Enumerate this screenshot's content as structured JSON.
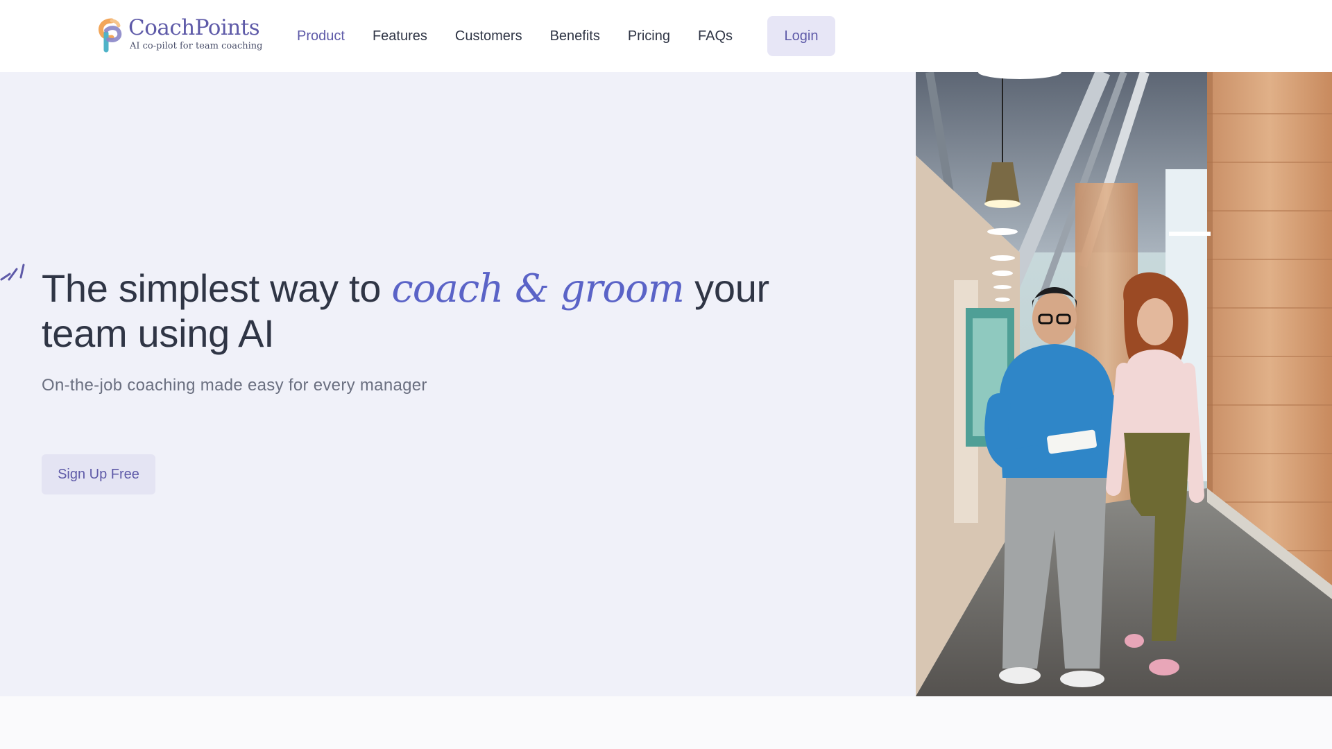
{
  "brand": {
    "name": "CoachPoints",
    "tagline": "AI co-pilot for team coaching",
    "logo_icon": "cp-logo-icon",
    "colors": {
      "primary": "#5e5aa8",
      "accent": "#5a63c7",
      "orange": "#f2a65a",
      "teal": "#4fb3c8"
    }
  },
  "nav": {
    "items": [
      {
        "label": "Product",
        "active": true
      },
      {
        "label": "Features"
      },
      {
        "label": "Customers"
      },
      {
        "label": "Benefits"
      },
      {
        "label": "Pricing"
      },
      {
        "label": "FAQs"
      }
    ],
    "login_label": "Login"
  },
  "hero": {
    "title_before": "The simplest way to ",
    "title_accent": "coach & groom",
    "title_after": " your team using AI",
    "subtitle": "On-the-job coaching made easy for every manager",
    "cta_label": "Sign Up Free",
    "sparkle_icon": "sparkle-icon",
    "background": "#f0f1f9"
  },
  "hero_image": {
    "subject": "office-corridor-two-colleagues-photo"
  }
}
